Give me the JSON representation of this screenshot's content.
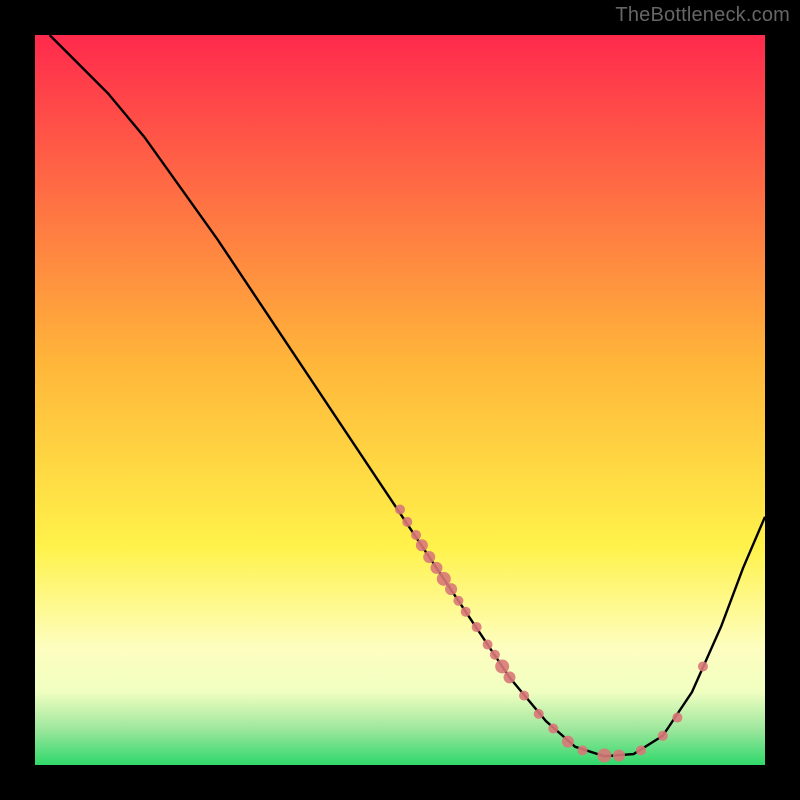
{
  "attribution": "TheBottleneck.com",
  "chart_data": {
    "type": "line",
    "title": "",
    "xlabel": "",
    "ylabel": "",
    "xlim": [
      0,
      100
    ],
    "ylim": [
      0,
      100
    ],
    "curve": [
      {
        "x": 2,
        "y": 100
      },
      {
        "x": 5,
        "y": 97
      },
      {
        "x": 10,
        "y": 92
      },
      {
        "x": 15,
        "y": 86
      },
      {
        "x": 20,
        "y": 79
      },
      {
        "x": 25,
        "y": 72
      },
      {
        "x": 30,
        "y": 64.5
      },
      {
        "x": 35,
        "y": 57
      },
      {
        "x": 40,
        "y": 49.5
      },
      {
        "x": 45,
        "y": 42
      },
      {
        "x": 50,
        "y": 34.5
      },
      {
        "x": 55,
        "y": 27
      },
      {
        "x": 60,
        "y": 19.5
      },
      {
        "x": 65,
        "y": 12
      },
      {
        "x": 70,
        "y": 6
      },
      {
        "x": 74,
        "y": 2.5
      },
      {
        "x": 78,
        "y": 1.2
      },
      {
        "x": 82,
        "y": 1.5
      },
      {
        "x": 86,
        "y": 4
      },
      {
        "x": 90,
        "y": 10
      },
      {
        "x": 94,
        "y": 19
      },
      {
        "x": 97,
        "y": 27
      },
      {
        "x": 100,
        "y": 34
      }
    ],
    "dots": [
      {
        "x": 50.0,
        "y": 35.0,
        "r": 5
      },
      {
        "x": 51.0,
        "y": 33.3,
        "r": 5
      },
      {
        "x": 52.2,
        "y": 31.5,
        "r": 5
      },
      {
        "x": 53.0,
        "y": 30.1,
        "r": 6
      },
      {
        "x": 54.0,
        "y": 28.5,
        "r": 6
      },
      {
        "x": 55.0,
        "y": 27.0,
        "r": 6
      },
      {
        "x": 56.0,
        "y": 25.5,
        "r": 7
      },
      {
        "x": 57.0,
        "y": 24.1,
        "r": 6
      },
      {
        "x": 58.0,
        "y": 22.5,
        "r": 5
      },
      {
        "x": 59.0,
        "y": 21.0,
        "r": 5
      },
      {
        "x": 60.5,
        "y": 18.9,
        "r": 5
      },
      {
        "x": 62.0,
        "y": 16.5,
        "r": 5
      },
      {
        "x": 63.0,
        "y": 15.1,
        "r": 5
      },
      {
        "x": 64.0,
        "y": 13.5,
        "r": 7
      },
      {
        "x": 65.0,
        "y": 12.0,
        "r": 6
      },
      {
        "x": 67.0,
        "y": 9.5,
        "r": 5
      },
      {
        "x": 69.0,
        "y": 7.0,
        "r": 5
      },
      {
        "x": 71.0,
        "y": 5.0,
        "r": 5
      },
      {
        "x": 73.0,
        "y": 3.2,
        "r": 6
      },
      {
        "x": 75.0,
        "y": 2.0,
        "r": 5
      },
      {
        "x": 78.0,
        "y": 1.3,
        "r": 7
      },
      {
        "x": 80.0,
        "y": 1.3,
        "r": 6
      },
      {
        "x": 83.0,
        "y": 2.0,
        "r": 5
      },
      {
        "x": 86.0,
        "y": 4.0,
        "r": 5
      },
      {
        "x": 88.0,
        "y": 6.5,
        "r": 5
      },
      {
        "x": 91.5,
        "y": 13.5,
        "r": 5
      }
    ],
    "dot_color": "#d97878",
    "gradient_stops": [
      {
        "offset": 0,
        "color": "#ff2a4d"
      },
      {
        "offset": 45,
        "color": "#ffb63a"
      },
      {
        "offset": 70,
        "color": "#fff24a"
      },
      {
        "offset": 84,
        "color": "#fdfec0"
      },
      {
        "offset": 90,
        "color": "#f0ffc0"
      },
      {
        "offset": 95,
        "color": "#9fe79e"
      },
      {
        "offset": 100,
        "color": "#2fd86b"
      }
    ]
  }
}
